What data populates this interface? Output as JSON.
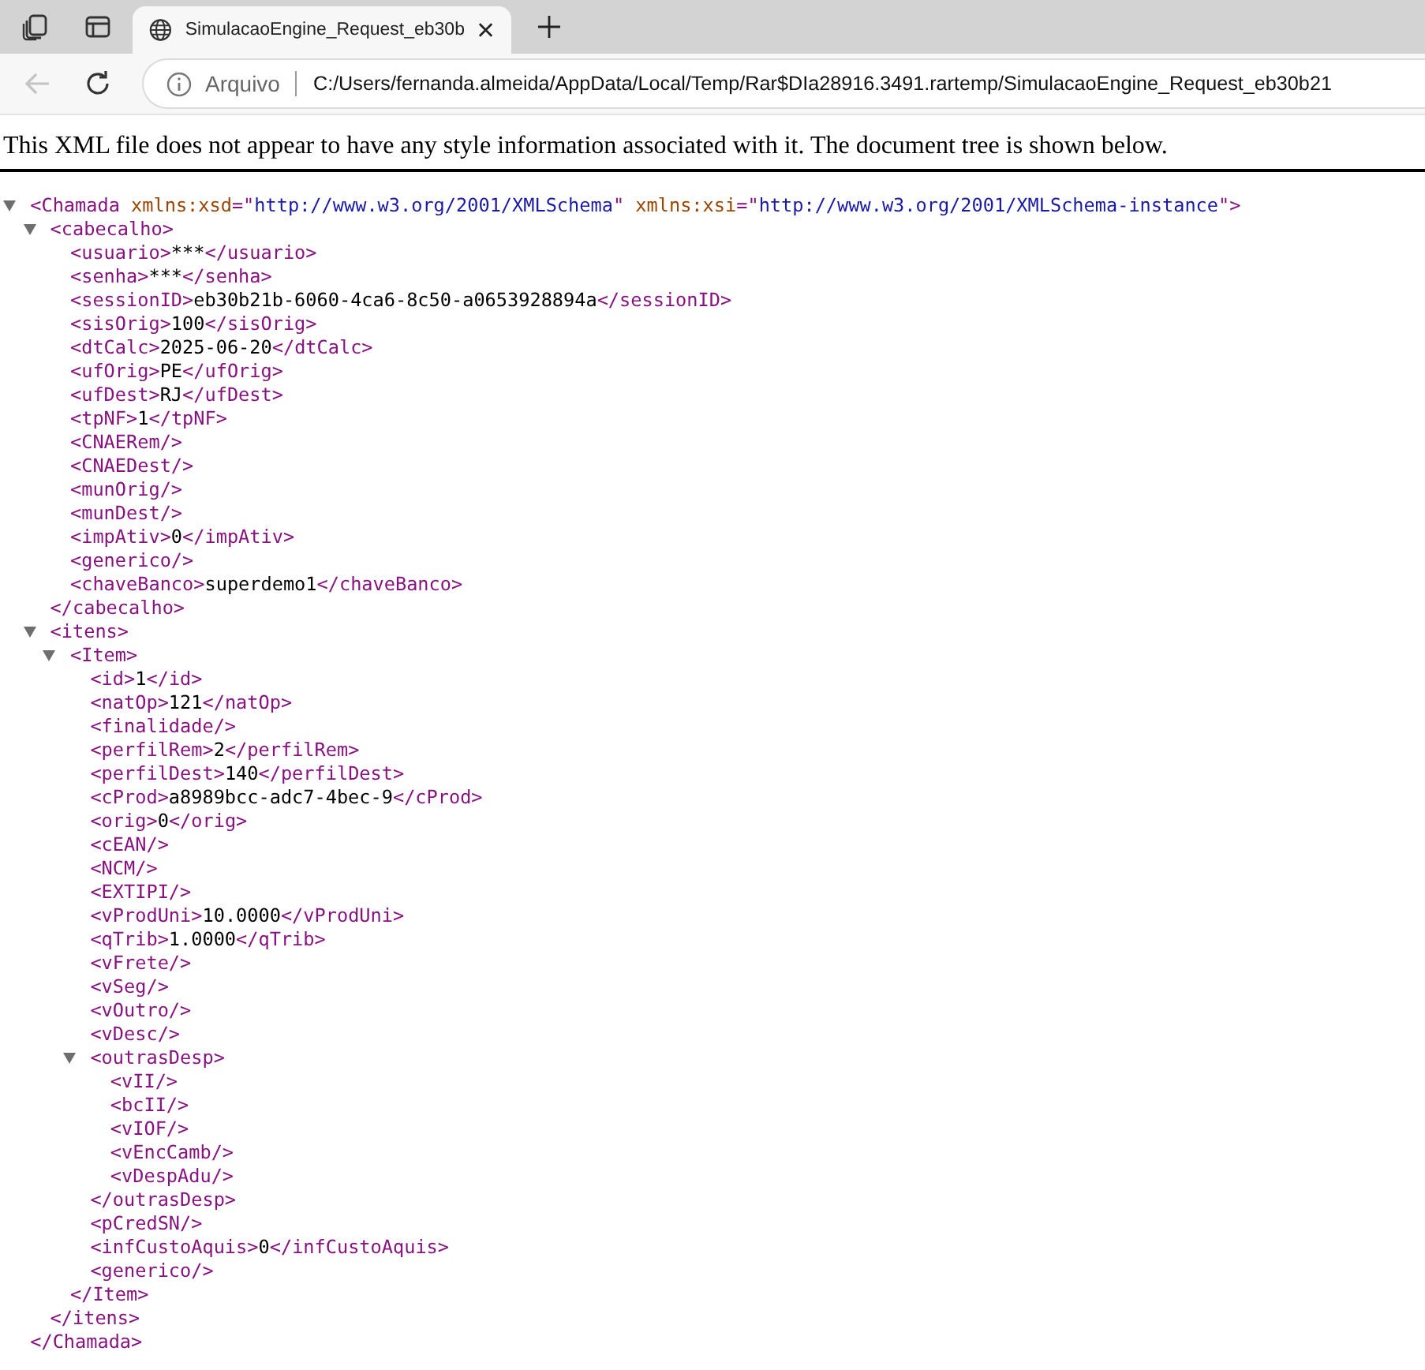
{
  "browser": {
    "tab": {
      "title": "SimulacaoEngine_Request_eb30b",
      "selected": true
    },
    "address_bar": {
      "back_disabled": true,
      "security_label": "Arquivo",
      "url": "C:/Users/fernanda.almeida/AppData/Local/Temp/Rar$DIa28916.3491.rartemp/SimulacaoEngine_Request_eb30b21"
    }
  },
  "notice": "This XML file does not appear to have any style information associated with it. The document tree is shown below.",
  "xml_tree": [
    {
      "tokens": [
        {
          "kind": "tag",
          "text": "<Chamada "
        },
        {
          "kind": "attr",
          "text": "xmlns:xsd"
        },
        {
          "kind": "tag",
          "text": "=\""
        },
        {
          "kind": "value",
          "text": "http://www.w3.org/2001/XMLSchema"
        },
        {
          "kind": "tag",
          "text": "\" "
        },
        {
          "kind": "attr",
          "text": "xmlns:xsi"
        },
        {
          "kind": "tag",
          "text": "=\""
        },
        {
          "kind": "value",
          "text": "http://www.w3.org/2001/XMLSchema-instance"
        },
        {
          "kind": "tag",
          "text": "\">"
        }
      ],
      "expanded": true,
      "closing": [
        {
          "kind": "tag",
          "text": "</Chamada>"
        }
      ],
      "children": [
        {
          "tokens": [
            {
              "kind": "tag",
              "text": "<cabecalho>"
            }
          ],
          "expanded": true,
          "closing": [
            {
              "kind": "tag",
              "text": "</cabecalho>"
            }
          ],
          "children": [
            {
              "tokens": [
                {
                  "kind": "tag",
                  "text": "<usuario>"
                },
                {
                  "kind": "text",
                  "text": "***"
                },
                {
                  "kind": "tag",
                  "text": "</usuario>"
                }
              ]
            },
            {
              "tokens": [
                {
                  "kind": "tag",
                  "text": "<senha>"
                },
                {
                  "kind": "text",
                  "text": "***"
                },
                {
                  "kind": "tag",
                  "text": "</senha>"
                }
              ]
            },
            {
              "tokens": [
                {
                  "kind": "tag",
                  "text": "<sessionID>"
                },
                {
                  "kind": "text",
                  "text": "eb30b21b-6060-4ca6-8c50-a0653928894a"
                },
                {
                  "kind": "tag",
                  "text": "</sessionID>"
                }
              ]
            },
            {
              "tokens": [
                {
                  "kind": "tag",
                  "text": "<sisOrig>"
                },
                {
                  "kind": "text",
                  "text": "100"
                },
                {
                  "kind": "tag",
                  "text": "</sisOrig>"
                }
              ]
            },
            {
              "tokens": [
                {
                  "kind": "tag",
                  "text": "<dtCalc>"
                },
                {
                  "kind": "text",
                  "text": "2025-06-20"
                },
                {
                  "kind": "tag",
                  "text": "</dtCalc>"
                }
              ]
            },
            {
              "tokens": [
                {
                  "kind": "tag",
                  "text": "<ufOrig>"
                },
                {
                  "kind": "text",
                  "text": "PE"
                },
                {
                  "kind": "tag",
                  "text": "</ufOrig>"
                }
              ]
            },
            {
              "tokens": [
                {
                  "kind": "tag",
                  "text": "<ufDest>"
                },
                {
                  "kind": "text",
                  "text": "RJ"
                },
                {
                  "kind": "tag",
                  "text": "</ufDest>"
                }
              ]
            },
            {
              "tokens": [
                {
                  "kind": "tag",
                  "text": "<tpNF>"
                },
                {
                  "kind": "text",
                  "text": "1"
                },
                {
                  "kind": "tag",
                  "text": "</tpNF>"
                }
              ]
            },
            {
              "tokens": [
                {
                  "kind": "tag",
                  "text": "<CNAERem/>"
                }
              ]
            },
            {
              "tokens": [
                {
                  "kind": "tag",
                  "text": "<CNAEDest/>"
                }
              ]
            },
            {
              "tokens": [
                {
                  "kind": "tag",
                  "text": "<munOrig/>"
                }
              ]
            },
            {
              "tokens": [
                {
                  "kind": "tag",
                  "text": "<munDest/>"
                }
              ]
            },
            {
              "tokens": [
                {
                  "kind": "tag",
                  "text": "<impAtiv>"
                },
                {
                  "kind": "text",
                  "text": "0"
                },
                {
                  "kind": "tag",
                  "text": "</impAtiv>"
                }
              ]
            },
            {
              "tokens": [
                {
                  "kind": "tag",
                  "text": "<generico/>"
                }
              ]
            },
            {
              "tokens": [
                {
                  "kind": "tag",
                  "text": "<chaveBanco>"
                },
                {
                  "kind": "text",
                  "text": "superdemo1"
                },
                {
                  "kind": "tag",
                  "text": "</chaveBanco>"
                }
              ]
            }
          ]
        },
        {
          "tokens": [
            {
              "kind": "tag",
              "text": "<itens>"
            }
          ],
          "expanded": true,
          "closing": [
            {
              "kind": "tag",
              "text": "</itens>"
            }
          ],
          "children": [
            {
              "tokens": [
                {
                  "kind": "tag",
                  "text": "<Item>"
                }
              ],
              "expanded": true,
              "closing": [
                {
                  "kind": "tag",
                  "text": "</Item>"
                }
              ],
              "children": [
                {
                  "tokens": [
                    {
                      "kind": "tag",
                      "text": "<id>"
                    },
                    {
                      "kind": "text",
                      "text": "1"
                    },
                    {
                      "kind": "tag",
                      "text": "</id>"
                    }
                  ]
                },
                {
                  "tokens": [
                    {
                      "kind": "tag",
                      "text": "<natOp>"
                    },
                    {
                      "kind": "text",
                      "text": "121"
                    },
                    {
                      "kind": "tag",
                      "text": "</natOp>"
                    }
                  ]
                },
                {
                  "tokens": [
                    {
                      "kind": "tag",
                      "text": "<finalidade/>"
                    }
                  ]
                },
                {
                  "tokens": [
                    {
                      "kind": "tag",
                      "text": "<perfilRem>"
                    },
                    {
                      "kind": "text",
                      "text": "2"
                    },
                    {
                      "kind": "tag",
                      "text": "</perfilRem>"
                    }
                  ]
                },
                {
                  "tokens": [
                    {
                      "kind": "tag",
                      "text": "<perfilDest>"
                    },
                    {
                      "kind": "text",
                      "text": "140"
                    },
                    {
                      "kind": "tag",
                      "text": "</perfilDest>"
                    }
                  ]
                },
                {
                  "tokens": [
                    {
                      "kind": "tag",
                      "text": "<cProd>"
                    },
                    {
                      "kind": "text",
                      "text": "a8989bcc-adc7-4bec-9"
                    },
                    {
                      "kind": "tag",
                      "text": "</cProd>"
                    }
                  ]
                },
                {
                  "tokens": [
                    {
                      "kind": "tag",
                      "text": "<orig>"
                    },
                    {
                      "kind": "text",
                      "text": "0"
                    },
                    {
                      "kind": "tag",
                      "text": "</orig>"
                    }
                  ]
                },
                {
                  "tokens": [
                    {
                      "kind": "tag",
                      "text": "<cEAN/>"
                    }
                  ]
                },
                {
                  "tokens": [
                    {
                      "kind": "tag",
                      "text": "<NCM/>"
                    }
                  ]
                },
                {
                  "tokens": [
                    {
                      "kind": "tag",
                      "text": "<EXTIPI/>"
                    }
                  ]
                },
                {
                  "tokens": [
                    {
                      "kind": "tag",
                      "text": "<vProdUni>"
                    },
                    {
                      "kind": "text",
                      "text": "10.0000"
                    },
                    {
                      "kind": "tag",
                      "text": "</vProdUni>"
                    }
                  ]
                },
                {
                  "tokens": [
                    {
                      "kind": "tag",
                      "text": "<qTrib>"
                    },
                    {
                      "kind": "text",
                      "text": "1.0000"
                    },
                    {
                      "kind": "tag",
                      "text": "</qTrib>"
                    }
                  ]
                },
                {
                  "tokens": [
                    {
                      "kind": "tag",
                      "text": "<vFrete/>"
                    }
                  ]
                },
                {
                  "tokens": [
                    {
                      "kind": "tag",
                      "text": "<vSeg/>"
                    }
                  ]
                },
                {
                  "tokens": [
                    {
                      "kind": "tag",
                      "text": "<vOutro/>"
                    }
                  ]
                },
                {
                  "tokens": [
                    {
                      "kind": "tag",
                      "text": "<vDesc/>"
                    }
                  ]
                },
                {
                  "tokens": [
                    {
                      "kind": "tag",
                      "text": "<outrasDesp>"
                    }
                  ],
                  "expanded": true,
                  "closing": [
                    {
                      "kind": "tag",
                      "text": "</outrasDesp>"
                    }
                  ],
                  "children": [
                    {
                      "tokens": [
                        {
                          "kind": "tag",
                          "text": "<vII/>"
                        }
                      ]
                    },
                    {
                      "tokens": [
                        {
                          "kind": "tag",
                          "text": "<bcII/>"
                        }
                      ]
                    },
                    {
                      "tokens": [
                        {
                          "kind": "tag",
                          "text": "<vIOF/>"
                        }
                      ]
                    },
                    {
                      "tokens": [
                        {
                          "kind": "tag",
                          "text": "<vEncCamb/>"
                        }
                      ]
                    },
                    {
                      "tokens": [
                        {
                          "kind": "tag",
                          "text": "<vDespAdu/>"
                        }
                      ]
                    }
                  ]
                },
                {
                  "tokens": [
                    {
                      "kind": "tag",
                      "text": "<pCredSN/>"
                    }
                  ]
                },
                {
                  "tokens": [
                    {
                      "kind": "tag",
                      "text": "<infCustoAquis>"
                    },
                    {
                      "kind": "text",
                      "text": "0"
                    },
                    {
                      "kind": "tag",
                      "text": "</infCustoAquis>"
                    }
                  ]
                },
                {
                  "tokens": [
                    {
                      "kind": "tag",
                      "text": "<generico/>"
                    }
                  ]
                }
              ]
            }
          ]
        }
      ]
    }
  ]
}
